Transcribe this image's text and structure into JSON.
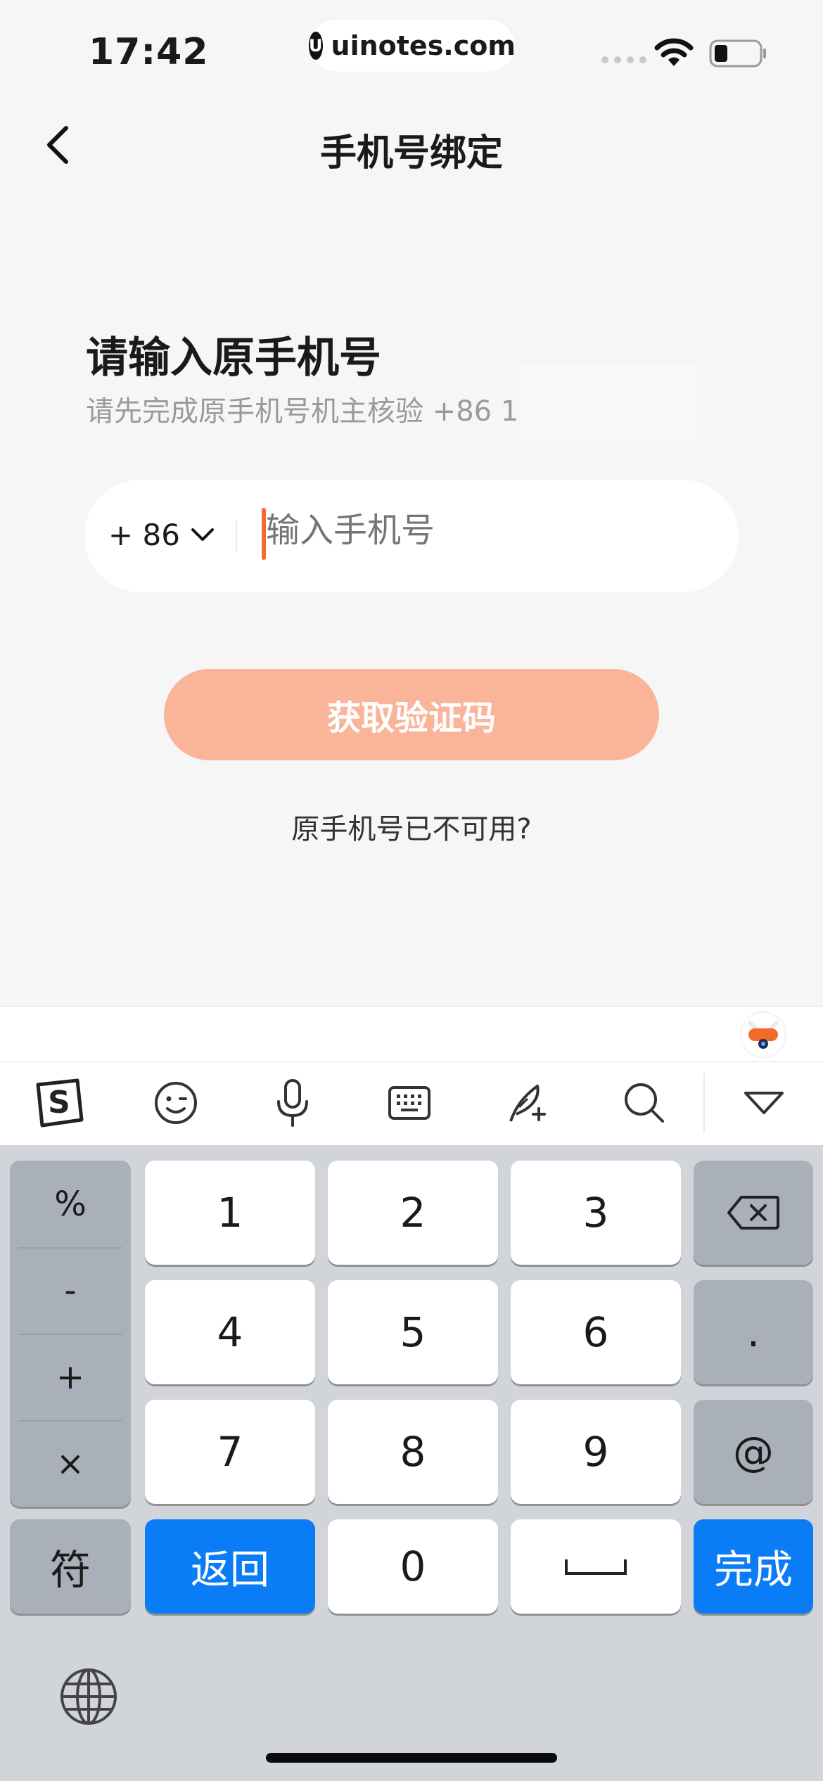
{
  "status_bar": {
    "time": "17:42",
    "site": "uinotes.com",
    "site_logo_letter": "U"
  },
  "nav": {
    "title": "手机号绑定",
    "back_icon": "chevron-left-icon"
  },
  "content": {
    "heading": "请输入原手机号",
    "subheading": "请先完成原手机号机主核验 +86 1",
    "phone_input": {
      "country_code": "+ 86",
      "placeholder": "输入手机号",
      "value": ""
    },
    "get_code_button": "获取验证码",
    "unavailable_link": "原手机号已不可用?"
  },
  "keyboard": {
    "toolbar_icons": [
      "sogou-logo-icon",
      "emoji-icon",
      "microphone-icon",
      "keyboard-icon",
      "handwriting-icon",
      "search-icon",
      "collapse-keyboard-icon"
    ],
    "symbols": [
      "%",
      "-",
      "+",
      "×"
    ],
    "digits": [
      "1",
      "2",
      "3",
      "4",
      "5",
      "6",
      "7",
      "8",
      "9",
      "0"
    ],
    "dot": ".",
    "at": "@",
    "symbol_key": "符",
    "return_key": "返回",
    "done_key": "完成",
    "accent_color": "#0a7cf5"
  },
  "colors": {
    "button_bg": "#f9b499",
    "cursor": "#f26a30",
    "page_bg": "#f6f6f6"
  }
}
